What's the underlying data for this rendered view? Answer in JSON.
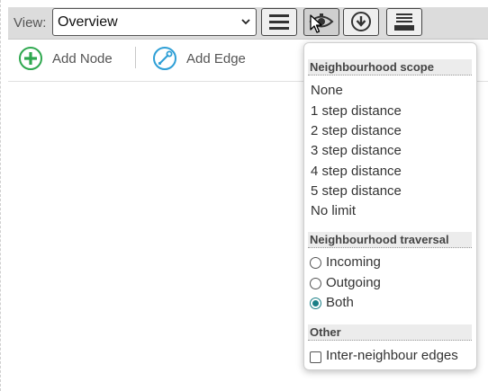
{
  "view_bar": {
    "label": "View:",
    "selected_view": "Overview",
    "buttons": [
      {
        "icon": "menu-icon"
      },
      {
        "icon": "eye-icon"
      },
      {
        "icon": "download-circle-icon"
      },
      {
        "icon": "layers-icon"
      }
    ]
  },
  "action_bar": {
    "add_node": {
      "label": "Add Node",
      "icon": "add-circle-icon",
      "color": "#2fa84f"
    },
    "add_edge": {
      "label": "Add Edge",
      "icon": "edge-link-icon",
      "color": "#2e9fd6"
    }
  },
  "dropdown": {
    "scope": {
      "heading": "Neighbourhood scope",
      "options": [
        "None",
        "1 step distance",
        "2 step distance",
        "3 step distance",
        "4 step distance",
        "5 step distance",
        "No limit"
      ]
    },
    "traversal": {
      "heading": "Neighbourhood traversal",
      "options": [
        {
          "label": "Incoming",
          "selected": false
        },
        {
          "label": "Outgoing",
          "selected": false
        },
        {
          "label": "Both",
          "selected": true
        }
      ]
    },
    "other": {
      "heading": "Other",
      "checkbox": {
        "label": "Inter-neighbour edges",
        "checked": false
      }
    }
  },
  "colors": {
    "accent": "#1a7f86",
    "toolbar_bg": "#dcdcdc"
  }
}
